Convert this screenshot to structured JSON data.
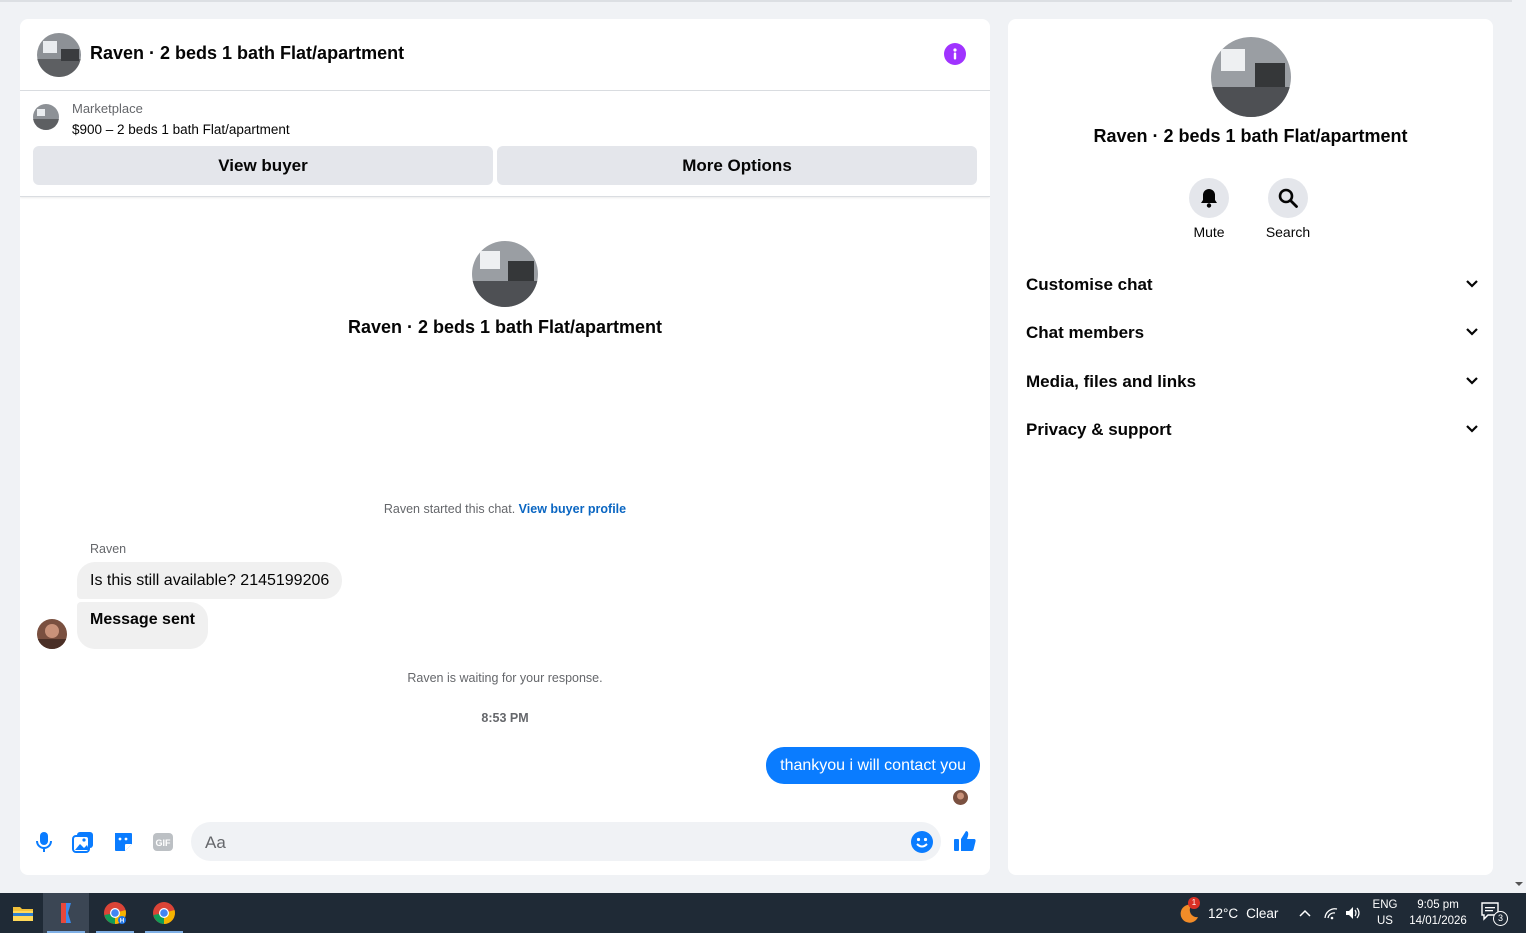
{
  "chat": {
    "title": "Raven · 2 beds 1 bath Flat/apartment",
    "listing": {
      "source": "Marketplace",
      "title": "$900 – 2 beds 1 bath Flat/apartment",
      "view_buyer_label": "View buyer",
      "more_options_label": "More Options"
    },
    "intro_title": "Raven · 2 beds 1 bath Flat/apartment",
    "system_note": "Raven started this chat.",
    "system_link": "View buyer profile",
    "sender_name": "Raven",
    "messages_in": [
      "Is this still available? 2145199206",
      "Message sent"
    ],
    "waiting_note": "Raven is waiting for your response.",
    "timestamp": "8:53 PM",
    "message_out": "thankyou i will contact you",
    "composer_placeholder": "Aa",
    "colors": {
      "accent": "#0a7cff",
      "info_button": "#a033ff",
      "link": "#0a66c2"
    },
    "composer_icons": [
      "microphone-icon",
      "photo-icon",
      "sticker-icon",
      "gif-icon",
      "emoji-icon",
      "thumbs-up-icon"
    ]
  },
  "info_panel": {
    "title": "Raven · 2 beds 1 bath Flat/apartment",
    "actions": [
      {
        "label": "Mute",
        "icon": "bell-icon"
      },
      {
        "label": "Search",
        "icon": "search-icon"
      }
    ],
    "sections": [
      "Customise chat",
      "Chat members",
      "Media, files and links",
      "Privacy & support"
    ]
  },
  "taskbar": {
    "apps": [
      "file-explorer-icon",
      "app-icon",
      "chrome-icon",
      "chrome-icon"
    ],
    "weather": {
      "temp": "12°C",
      "condition": "Clear",
      "badge": "1"
    },
    "language": {
      "lang": "ENG",
      "region": "US"
    },
    "clock": {
      "time": "9:05 pm",
      "date": "14/01/2026"
    },
    "notification_count": "3"
  }
}
